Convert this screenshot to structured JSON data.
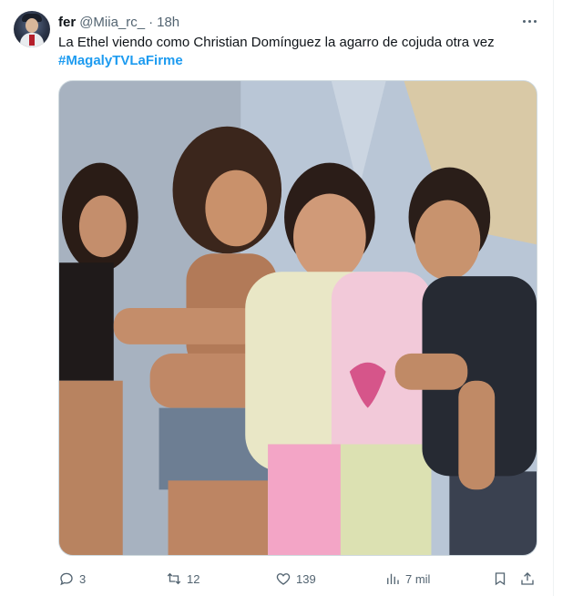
{
  "tweet": {
    "author_name": "fer",
    "author_handle": "@Miia_rc_",
    "separator": "·",
    "time": "18h",
    "text": "La Ethel viendo como Christian Domínguez la agarro de cojuda otra vez",
    "hashtag": "#MagalyTVLaFirme"
  },
  "actions": {
    "replies": "3",
    "retweets": "12",
    "likes": "139",
    "views": "7 mil"
  },
  "colors": {
    "link": "#1d9bf0",
    "secondary_text": "#536471",
    "primary_text": "#0f1419"
  },
  "icons": [
    "more-icon",
    "reply-icon",
    "retweet-icon",
    "like-icon",
    "views-icon",
    "bookmark-icon",
    "share-icon"
  ]
}
